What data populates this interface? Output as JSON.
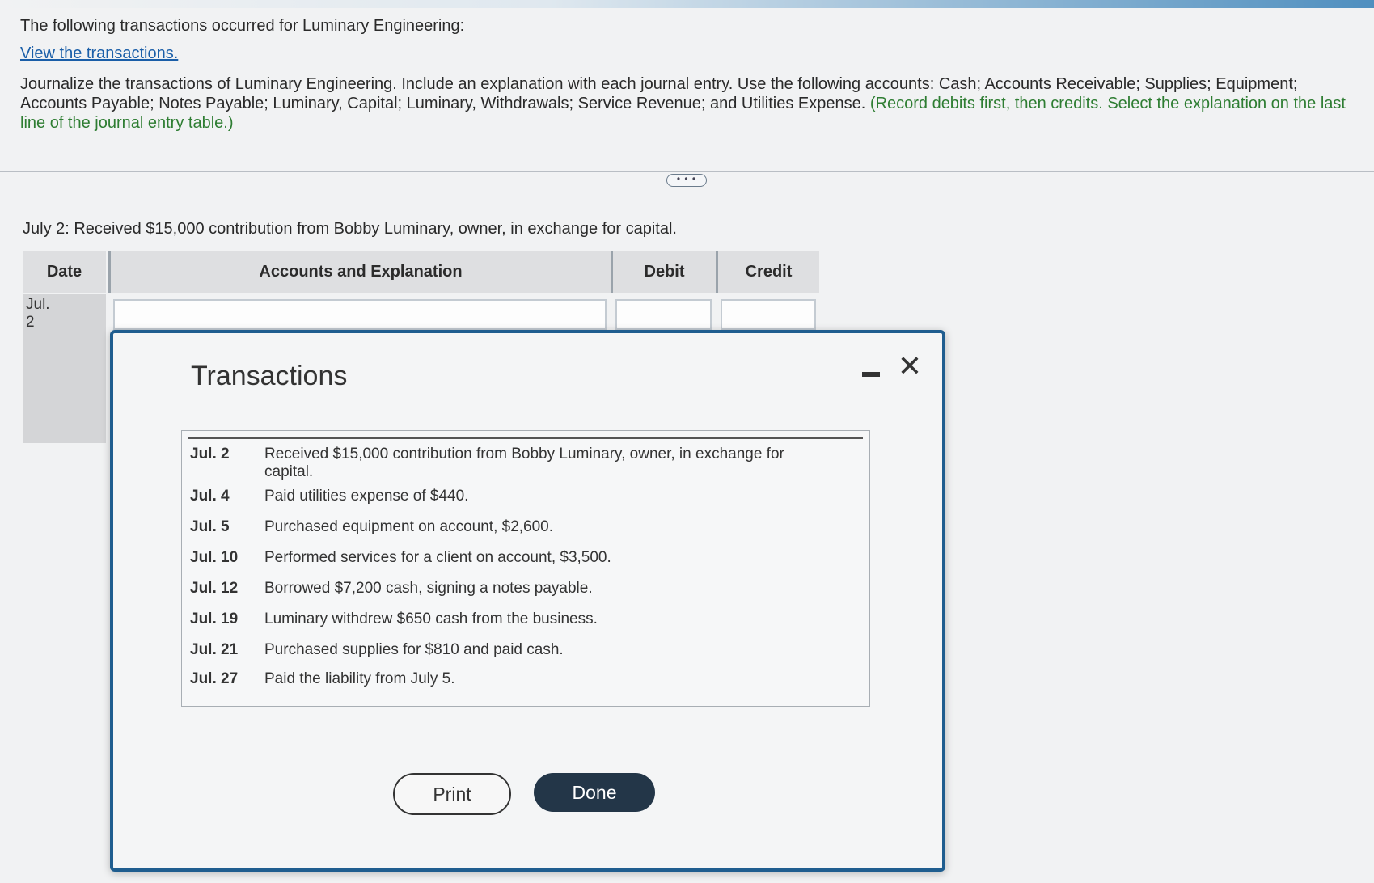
{
  "intro": {
    "heading": "The following transactions occurred for Luminary Engineering:",
    "link": "View the transactions.",
    "instruction": "Journalize the transactions of Luminary Engineering. Include an explanation with each journal entry. Use the following accounts: Cash; Accounts Receivable; Supplies; Equipment; Accounts Payable; Notes Payable; Luminary, Capital; Luminary, Withdrawals; Service Revenue; and Utilities Expense.",
    "note": "(Record debits first, then credits. Select the explanation on the last line of the journal entry table.)"
  },
  "more_button": "• • •",
  "prompt": "July 2: Received $15,000 contribution from Bobby Luminary, owner, in exchange for capital.",
  "journal": {
    "headers": {
      "date": "Date",
      "accounts": "Accounts and Explanation",
      "debit": "Debit",
      "credit": "Credit"
    },
    "row_date": "Jul. 2"
  },
  "modal": {
    "title": "Transactions",
    "close_glyph": "✕",
    "transactions": [
      {
        "date": "Jul. 2",
        "desc": "Received $15,000 contribution from Bobby Luminary, owner, in exchange for capital."
      },
      {
        "date": "Jul. 4",
        "desc": "Paid utilities expense of $440."
      },
      {
        "date": "Jul. 5",
        "desc": "Purchased equipment on account, $2,600."
      },
      {
        "date": "Jul. 10",
        "desc": "Performed services for a client on account, $3,500."
      },
      {
        "date": "Jul. 12",
        "desc": "Borrowed $7,200 cash, signing a notes payable."
      },
      {
        "date": "Jul. 19",
        "desc": "Luminary withdrew $650 cash from the business."
      },
      {
        "date": "Jul. 21",
        "desc": "Purchased supplies for $810 and paid cash."
      },
      {
        "date": "Jul. 27",
        "desc": "Paid the liability from July 5."
      }
    ],
    "buttons": {
      "print": "Print",
      "done": "Done"
    }
  }
}
